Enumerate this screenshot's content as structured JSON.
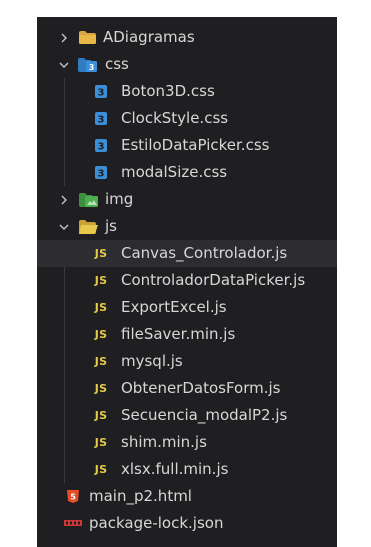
{
  "explorer": {
    "items": [
      {
        "label": "ADiagramas",
        "type": "folder",
        "icon": "folder-icon",
        "expanded": false
      },
      {
        "label": "css",
        "type": "folder",
        "icon": "css-folder-icon",
        "expanded": true
      },
      {
        "label": "Boton3D.css",
        "type": "file",
        "icon": "css-file-icon"
      },
      {
        "label": "ClockStyle.css",
        "type": "file",
        "icon": "css-file-icon"
      },
      {
        "label": "EstiloDataPicker.css",
        "type": "file",
        "icon": "css-file-icon"
      },
      {
        "label": "modalSize.css",
        "type": "file",
        "icon": "css-file-icon"
      },
      {
        "label": "img",
        "type": "folder",
        "icon": "image-folder-icon",
        "expanded": false
      },
      {
        "label": "js",
        "type": "folder",
        "icon": "js-folder-icon",
        "expanded": true
      },
      {
        "label": "Canvas_Controlador.js",
        "type": "file",
        "icon": "js-file-icon",
        "badge": "JS",
        "selected": true
      },
      {
        "label": "ControladorDataPicker.js",
        "type": "file",
        "icon": "js-file-icon",
        "badge": "JS"
      },
      {
        "label": "ExportExcel.js",
        "type": "file",
        "icon": "js-file-icon",
        "badge": "JS"
      },
      {
        "label": "fileSaver.min.js",
        "type": "file",
        "icon": "js-file-icon",
        "badge": "JS"
      },
      {
        "label": "mysql.js",
        "type": "file",
        "icon": "js-file-icon",
        "badge": "JS"
      },
      {
        "label": "ObtenerDatosForm.js",
        "type": "file",
        "icon": "js-file-icon",
        "badge": "JS"
      },
      {
        "label": "Secuencia_modalP2.js",
        "type": "file",
        "icon": "js-file-icon",
        "badge": "JS"
      },
      {
        "label": "shim.min.js",
        "type": "file",
        "icon": "js-file-icon",
        "badge": "JS"
      },
      {
        "label": "xlsx.full.min.js",
        "type": "file",
        "icon": "js-file-icon",
        "badge": "JS"
      },
      {
        "label": "main_p2.html",
        "type": "file",
        "icon": "html-file-icon"
      },
      {
        "label": "package-lock.json",
        "type": "file",
        "icon": "npm-file-icon"
      }
    ]
  },
  "colors": {
    "panel_bg": "#1f1f22",
    "selected_bg": "#2d2d31",
    "text": "#d7d7d7",
    "js_yellow": "#e6c84a",
    "css_blue": "#3b8fd9",
    "html_orange": "#e44d26",
    "folder_yellow": "#e8b84a",
    "img_green": "#4caf50",
    "npm_red": "#cb3837"
  }
}
